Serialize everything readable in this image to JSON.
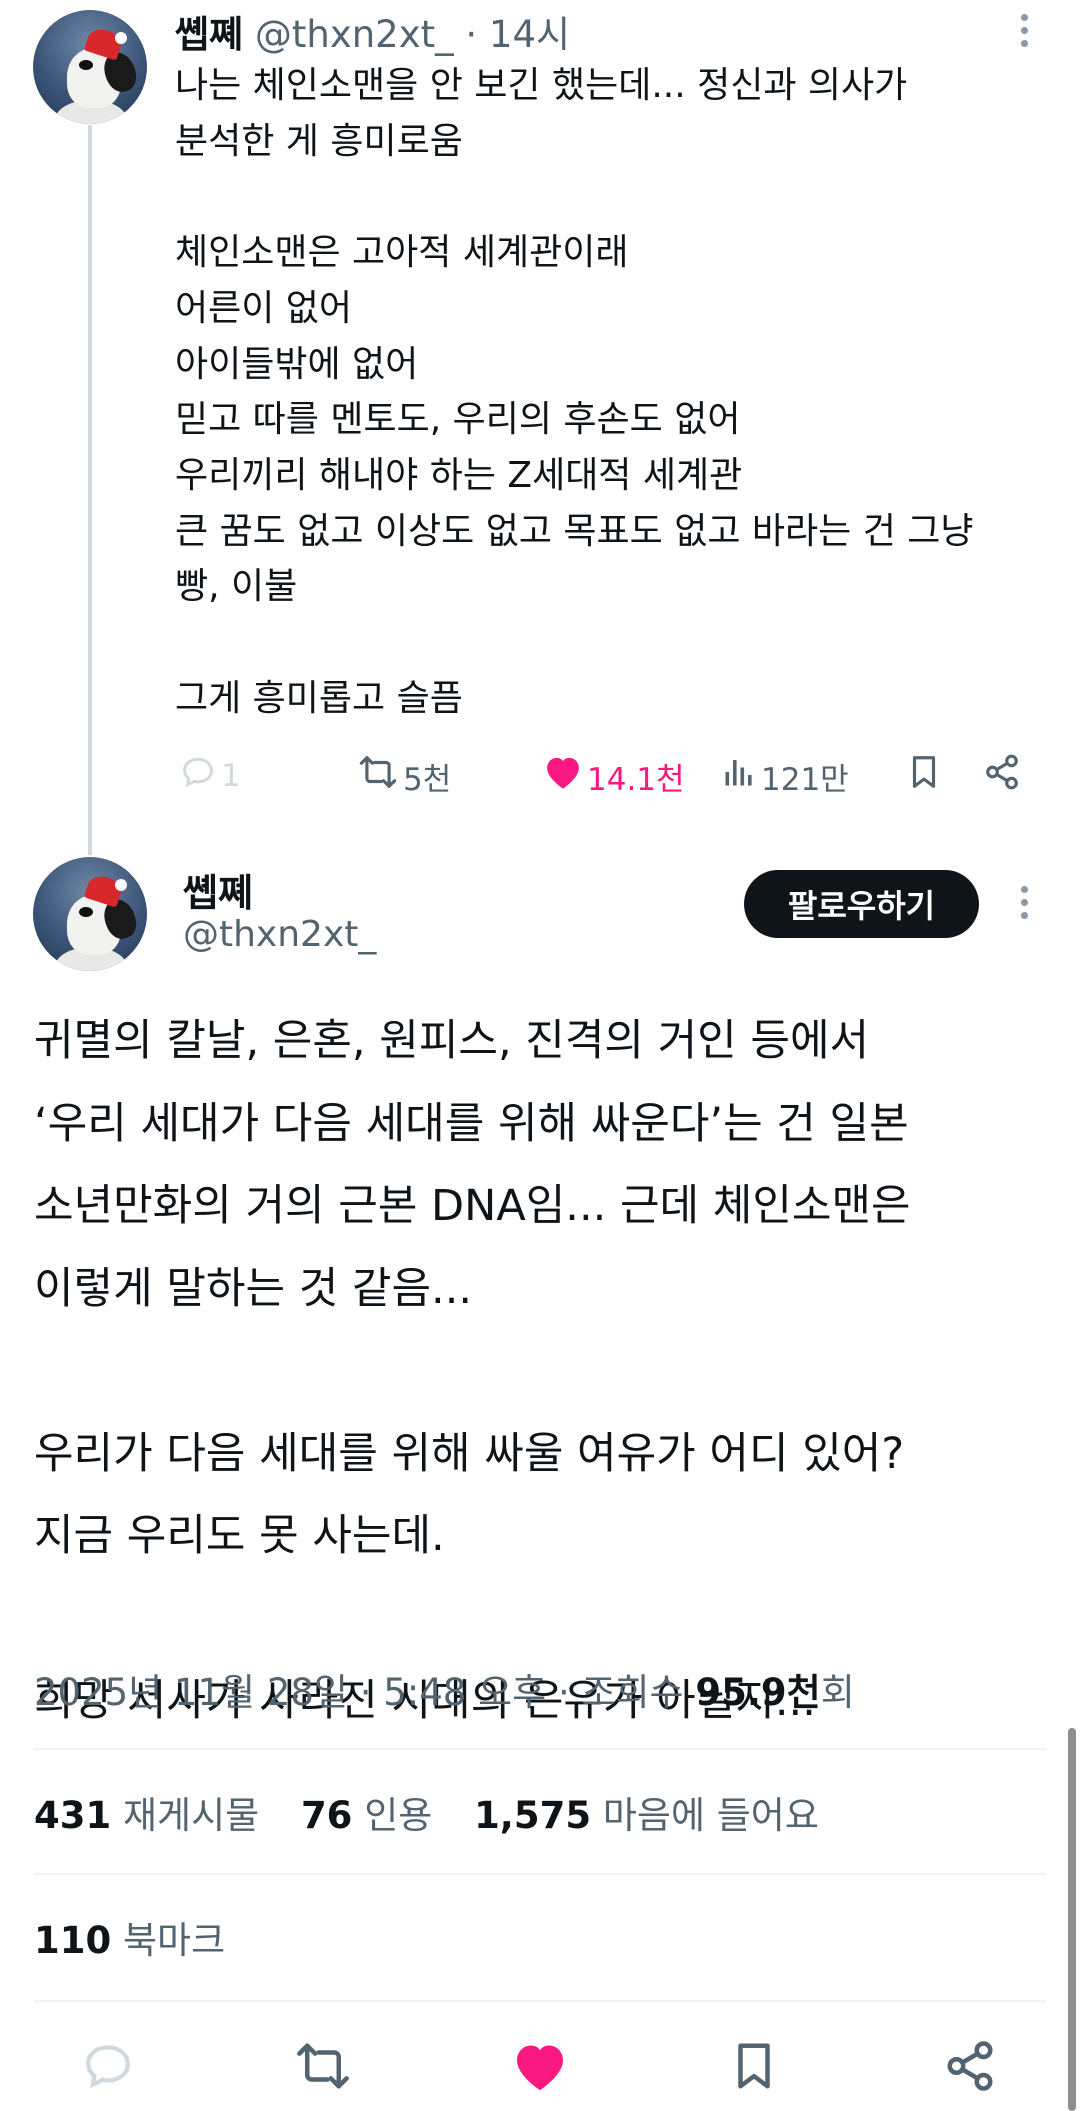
{
  "reply": {
    "name": "쏍쪠",
    "handle": "@thxn2xt_",
    "separator": "·",
    "time": "14시",
    "text": "나는 체인소맨을 안 보긴 했는데... 정신과 의사가\n분석한 게 흥미로움\n\n체인소맨은 고아적 세계관이래\n어른이 없어\n아이들밖에 없어\n믿고 따를 멘토도, 우리의 후손도 없어\n우리끼리 해내야 하는 Z세대적 세계관\n큰 꿈도 없고 이상도 없고 목표도 없고 바라는 건 그냥\n빵, 이불\n\n그게 흥미롭고 슬픔￼",
    "actions": {
      "replies": "1",
      "reposts": "5천",
      "likes": "14.1천",
      "views": "121만"
    }
  },
  "main": {
    "name": "쏍쪠",
    "handle": "@thxn2xt_",
    "follow_label": "팔로우하기",
    "text": "귀멸의 칼날, 은혼, 원피스, 진격의 거인 등에서\n‘우리 세대가 다음 세대를 위해 싸운다’는 건 일본\n소년만화의 거의 근본 DNA임... 근데 체인소맨은\n이렇게 말하는 것 같음...\n\n우리가 다음 세대를 위해 싸울 여유가 어디 있어?\n지금 우리도 못 사는데.\n\n희망 서사가 사라진 시대의 은유가 아닐지...",
    "meta_date": "2025년 11월 28일 · 5:48 오후 · 조회수 ",
    "meta_views": "95.9천",
    "meta_views_suffix": "회",
    "stats": {
      "reposts_num": "431",
      "reposts_label": "재게시물",
      "quotes_num": "76",
      "quotes_label": "인용",
      "likes_num": "1,575",
      "likes_label": "마음에 들어요"
    },
    "bookmarks_num": "110",
    "bookmarks_label": "북마크"
  },
  "colors": {
    "like_pink": "#f91880",
    "muted_text": "#536471",
    "primary_text": "#0f1419",
    "follow_bg": "#0f1419"
  },
  "icons": [
    "reply-icon",
    "repost-icon",
    "heart-icon",
    "views-icon",
    "bookmark-icon",
    "share-icon",
    "more-icon"
  ]
}
